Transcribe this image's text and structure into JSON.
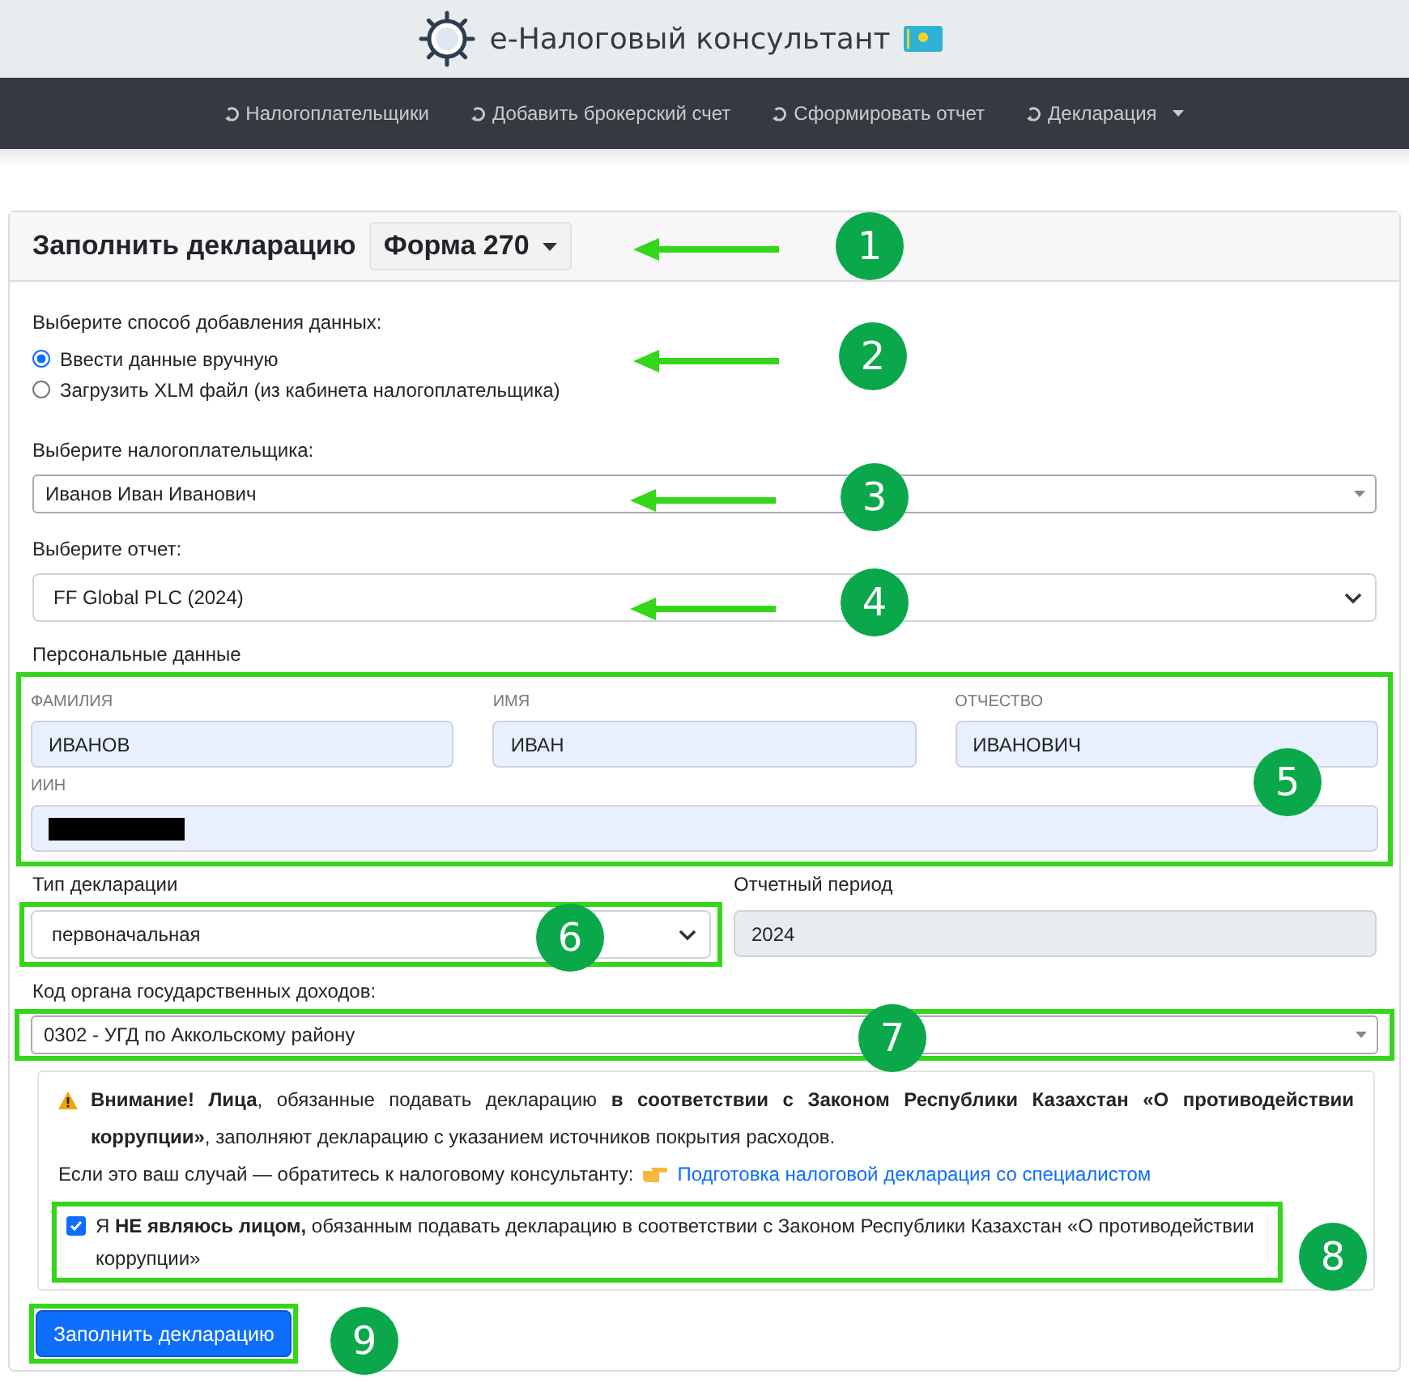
{
  "header": {
    "title": "e-Налоговый консультант"
  },
  "nav": [
    {
      "label": "Налогоплательщики",
      "dropdown": false
    },
    {
      "label": "Добавить брокерский счет",
      "dropdown": false
    },
    {
      "label": "Сформировать отчет",
      "dropdown": false
    },
    {
      "label": "Декларация",
      "dropdown": true
    }
  ],
  "card": {
    "title": "Заполнить декларацию",
    "form_button": "Форма 270"
  },
  "data_source": {
    "label": "Выберите способ добавления данных:",
    "options": [
      {
        "label": "Ввести данные вручную",
        "selected": true
      },
      {
        "label": "Загрузить XLM файл (из кабинета налогоплательщика)",
        "selected": false
      }
    ]
  },
  "taxpayer": {
    "label": "Выберите налогоплательщика:",
    "value": "Иванов Иван Иванович"
  },
  "report": {
    "label": "Выберите отчет:",
    "value": "FF Global PLC (2024)"
  },
  "personal": {
    "title": "Персональные данные",
    "fields": [
      {
        "label": "ФАМИЛИЯ",
        "value": "ИВАНОВ"
      },
      {
        "label": "ИМЯ",
        "value": "ИВАН"
      },
      {
        "label": "ОТЧЕСТВО",
        "value": "ИВАНОВИЧ"
      }
    ],
    "iin": {
      "label": "ИИН",
      "redacted": true
    }
  },
  "declaration_type": {
    "label": "Тип декларации",
    "value": "первоначальная"
  },
  "period": {
    "label": "Отчетный период",
    "value": "2024"
  },
  "authority": {
    "label": "Код органа государственных доходов:",
    "value": "0302 - УГД по Аккольскому району"
  },
  "warning": {
    "text": "**Внимание! Лица**, обязанные подавать декларацию **в соответствии с Законом Республики Казахстан «О противодействии коррупции»**, заполняют декларацию с указанием источников покрытия расходов.",
    "hint": "Если это ваш случай — обратитесь к налоговому консультанту:",
    "link": "Подготовка налоговой декларация со специалистом"
  },
  "confirm": {
    "text": "Я **НЕ являюсь лицом,** обязанным подавать декларацию в соответствии с Законом Республики Казахстан «О противодействии коррупции»",
    "checked": true
  },
  "submit": "Заполнить декларацию",
  "annotations": [
    {
      "number": "1",
      "arrow": true,
      "box": false
    },
    {
      "number": "2",
      "arrow": true,
      "box": false
    },
    {
      "number": "3",
      "arrow": true,
      "box": false
    },
    {
      "number": "4",
      "arrow": true,
      "box": false
    },
    {
      "number": "5",
      "arrow": false,
      "box": true
    },
    {
      "number": "6",
      "arrow": false,
      "box": true
    },
    {
      "number": "7",
      "arrow": false,
      "box": true
    },
    {
      "number": "8",
      "arrow": false,
      "box": true
    },
    {
      "number": "9",
      "arrow": false,
      "box": true
    }
  ]
}
